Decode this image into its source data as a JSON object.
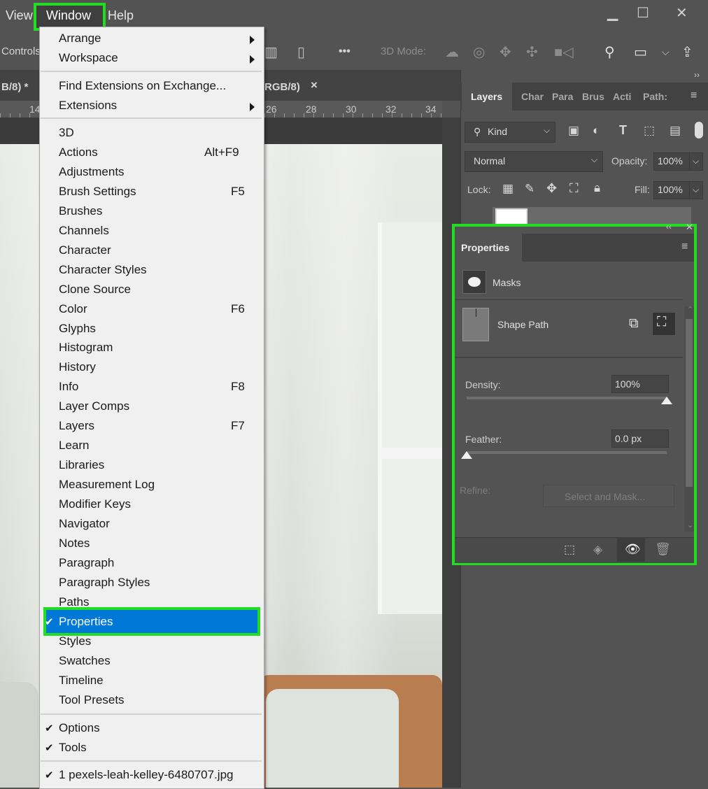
{
  "menubar": {
    "view": "View",
    "window": "Window",
    "help": "Help",
    "win_controls": [
      "▁",
      "☐",
      "✕"
    ]
  },
  "options_bar": {
    "controls": "Controls",
    "three_d_mode": "3D Mode:",
    "more": "•••"
  },
  "doc_tabs": {
    "left": "B/8) *",
    "right": "RGB/8)",
    "close": "×"
  },
  "ruler": [
    "14",
    "26",
    "28",
    "30",
    "32",
    "34"
  ],
  "window_menu": {
    "submenus": [
      "Arrange",
      "Workspace"
    ],
    "ext": [
      "Find Extensions on Exchange...",
      "Extensions"
    ],
    "panels": [
      {
        "label": "3D",
        "shortcut": ""
      },
      {
        "label": "Actions",
        "shortcut": "Alt+F9"
      },
      {
        "label": "Adjustments",
        "shortcut": ""
      },
      {
        "label": "Brush Settings",
        "shortcut": "F5"
      },
      {
        "label": "Brushes",
        "shortcut": ""
      },
      {
        "label": "Channels",
        "shortcut": ""
      },
      {
        "label": "Character",
        "shortcut": ""
      },
      {
        "label": "Character Styles",
        "shortcut": ""
      },
      {
        "label": "Clone Source",
        "shortcut": ""
      },
      {
        "label": "Color",
        "shortcut": "F6"
      },
      {
        "label": "Glyphs",
        "shortcut": ""
      },
      {
        "label": "Histogram",
        "shortcut": ""
      },
      {
        "label": "History",
        "shortcut": ""
      },
      {
        "label": "Info",
        "shortcut": "F8"
      },
      {
        "label": "Layer Comps",
        "shortcut": ""
      },
      {
        "label": "Layers",
        "shortcut": "F7"
      },
      {
        "label": "Learn",
        "shortcut": ""
      },
      {
        "label": "Libraries",
        "shortcut": ""
      },
      {
        "label": "Measurement Log",
        "shortcut": ""
      },
      {
        "label": "Modifier Keys",
        "shortcut": ""
      },
      {
        "label": "Navigator",
        "shortcut": ""
      },
      {
        "label": "Notes",
        "shortcut": ""
      },
      {
        "label": "Paragraph",
        "shortcut": ""
      },
      {
        "label": "Paragraph Styles",
        "shortcut": ""
      },
      {
        "label": "Paths",
        "shortcut": ""
      },
      {
        "label": "Properties",
        "shortcut": "",
        "checked": true,
        "selected": true
      },
      {
        "label": "Styles",
        "shortcut": ""
      },
      {
        "label": "Swatches",
        "shortcut": ""
      },
      {
        "label": "Timeline",
        "shortcut": ""
      },
      {
        "label": "Tool Presets",
        "shortcut": ""
      }
    ],
    "options": [
      "Options",
      "Tools"
    ],
    "documents": [
      "1 pexels-leah-kelley-6480707.jpg"
    ]
  },
  "layers_panel": {
    "tabs": [
      "Layers",
      "Char",
      "Para",
      "Brus",
      "Acti",
      "Path:"
    ],
    "kind": "Kind",
    "blend_mode": "Normal",
    "opacity_label": "Opacity:",
    "opacity_value": "100%",
    "lock_label": "Lock:",
    "fill_label": "Fill:",
    "fill_value": "100%"
  },
  "properties_panel": {
    "title": "Properties",
    "masks_label": "Masks",
    "shape_path_label": "Shape Path",
    "density_label": "Density:",
    "density_value": "100%",
    "density_fraction": 1.0,
    "feather_label": "Feather:",
    "feather_value": "0.0 px",
    "feather_fraction": 0.0,
    "refine_label": "Refine:",
    "select_mask_button": "Select and Mask..."
  },
  "colors": {
    "highlight": "#0078d7",
    "annotation": "#22dd22"
  }
}
